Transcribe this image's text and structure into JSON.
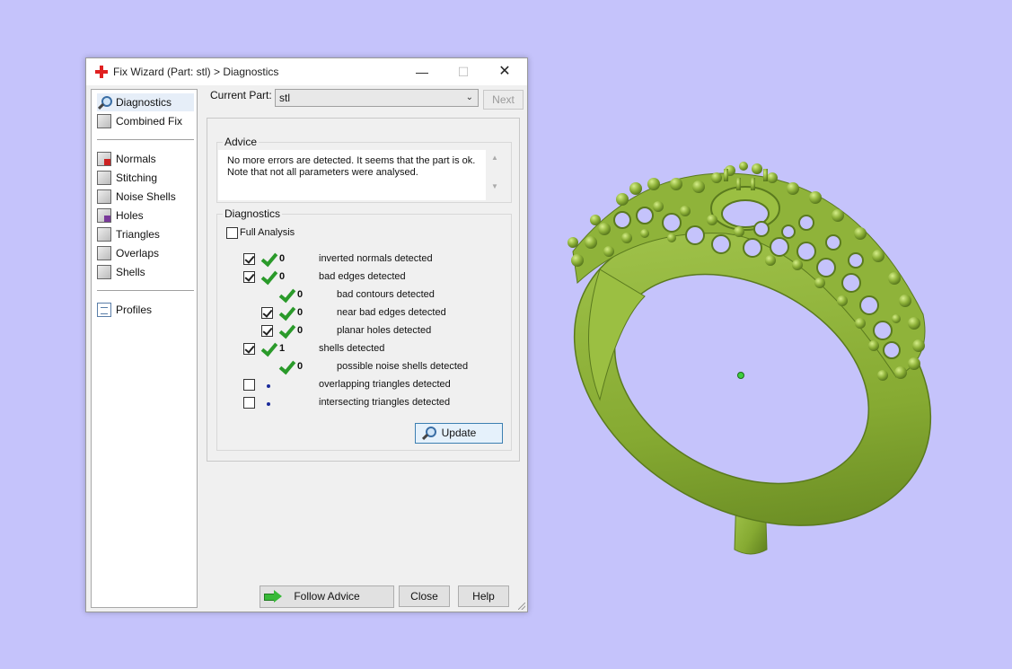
{
  "window": {
    "title": "Fix Wizard (Part: stl) > Diagnostics",
    "minimize_glyph": "—",
    "maximize_glyph": "☐",
    "close_glyph": "✕"
  },
  "sidebar": {
    "items": [
      {
        "label": "Diagnostics",
        "icon": "magnifier-icon",
        "selected": true
      },
      {
        "label": "Combined Fix",
        "icon": "cube-icon"
      },
      {
        "label": "Normals",
        "icon": "cube-red-icon"
      },
      {
        "label": "Stitching",
        "icon": "cube-icon"
      },
      {
        "label": "Noise Shells",
        "icon": "dice-icon"
      },
      {
        "label": "Holes",
        "icon": "cube-purple-icon"
      },
      {
        "label": "Triangles",
        "icon": "triangles-icon"
      },
      {
        "label": "Overlaps",
        "icon": "overlaps-icon"
      },
      {
        "label": "Shells",
        "icon": "cube-icon"
      },
      {
        "label": "Profiles",
        "icon": "document-icon"
      }
    ]
  },
  "current_part": {
    "label": "Current Part:",
    "value": "stl",
    "next_label": "Next"
  },
  "advice": {
    "title": "Advice",
    "line1": "No more errors are detected. It seems that the part is ok.",
    "line2": "Note that not all parameters were analysed."
  },
  "diagnostics": {
    "title": "Diagnostics",
    "full_analysis_label": "Full Analysis",
    "full_analysis_checked": false,
    "rows": [
      {
        "checkbox": true,
        "checked": true,
        "status": "ok",
        "count": "0",
        "label": "inverted normals detected",
        "indent": 0
      },
      {
        "checkbox": true,
        "checked": true,
        "status": "ok",
        "count": "0",
        "label": "bad edges detected",
        "indent": 0
      },
      {
        "checkbox": false,
        "checked": false,
        "status": "ok",
        "count": "0",
        "label": "bad contours detected",
        "indent": 1
      },
      {
        "checkbox": true,
        "checked": true,
        "status": "ok",
        "count": "0",
        "label": "near bad edges detected",
        "indent": 1
      },
      {
        "checkbox": true,
        "checked": true,
        "status": "ok",
        "count": "0",
        "label": "planar holes detected",
        "indent": 1
      },
      {
        "checkbox": true,
        "checked": true,
        "status": "ok",
        "count": "1",
        "label": "shells detected",
        "indent": 0
      },
      {
        "checkbox": false,
        "checked": false,
        "status": "ok",
        "count": "0",
        "label": "possible noise shells detected",
        "indent": 1
      },
      {
        "checkbox": true,
        "checked": false,
        "status": "dot",
        "count": "",
        "label": "overlapping triangles detected",
        "indent": 0
      },
      {
        "checkbox": true,
        "checked": false,
        "status": "dot",
        "count": "",
        "label": "intersecting triangles detected",
        "indent": 0
      }
    ],
    "update_label": "Update"
  },
  "footer": {
    "follow_advice_label": "Follow Advice",
    "close_label": "Close",
    "help_label": "Help"
  },
  "colors": {
    "background": "#c5c3fb",
    "model": "#8fb33a",
    "check_green": "#2a9a2a"
  }
}
